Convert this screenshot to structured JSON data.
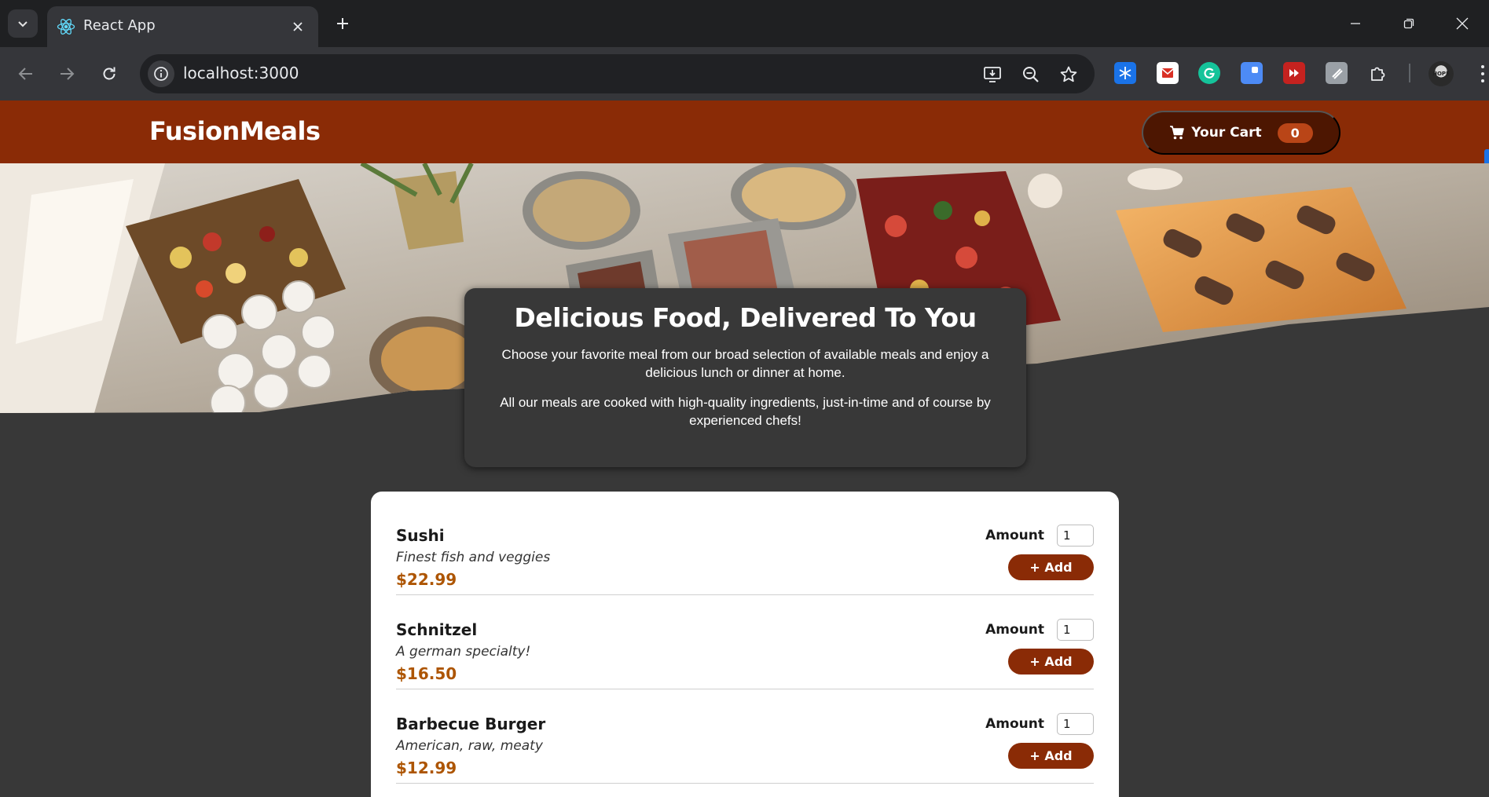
{
  "browser": {
    "tab_title": "React App",
    "url": "localhost:3000",
    "profile_text": "HOPE"
  },
  "header": {
    "brand": "FusionMeals",
    "cart_label": "Your Cart",
    "cart_count": "0"
  },
  "summary": {
    "title": "Delicious Food, Delivered To You",
    "paragraph_1": "Choose your favorite meal from our broad selection of available meals and enjoy a delicious lunch or dinner at home.",
    "paragraph_2": "All our meals are cooked with high-quality ingredients, just-in-time and of course by experienced chefs!"
  },
  "meals": [
    {
      "name": "Sushi",
      "description": "Finest fish and veggies",
      "price": "$22.99",
      "amount_label": "Amount",
      "amount": "1",
      "add_label": "+ Add"
    },
    {
      "name": "Schnitzel",
      "description": "A german specialty!",
      "price": "$16.50",
      "amount_label": "Amount",
      "amount": "1",
      "add_label": "+ Add"
    },
    {
      "name": "Barbecue Burger",
      "description": "American, raw, meaty",
      "price": "$12.99",
      "amount_label": "Amount",
      "amount": "1",
      "add_label": "+ Add"
    }
  ],
  "colors": {
    "header_bg": "#8a2b06",
    "cart_bg": "#4d1601",
    "badge_bg": "#b94517",
    "price": "#ad5502",
    "page_bg": "#383838"
  },
  "icons": {
    "tab_menu": "chevron-down-icon",
    "favicon": "react-logo-icon",
    "tab_close": "close-icon",
    "new_tab": "plus-icon",
    "back": "arrow-left-icon",
    "forward": "arrow-right-icon",
    "reload": "reload-icon",
    "site_info": "info-icon",
    "install": "install-app-icon",
    "zoom": "zoom-out-icon",
    "bookmark": "star-icon",
    "extensions": "puzzle-icon",
    "cart": "cart-icon"
  }
}
